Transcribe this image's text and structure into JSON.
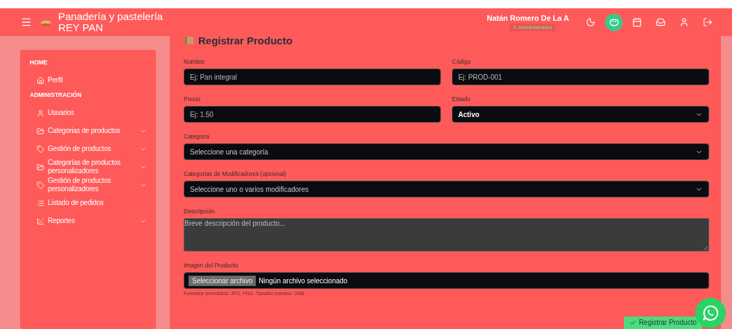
{
  "header": {
    "title_lines": [
      "Panadería y pastelería",
      "REY PAN"
    ],
    "user_name": "Natán Romero De La A",
    "user_role": "Administrador"
  },
  "sidebar": {
    "sections": [
      {
        "title": "HOME",
        "items": [
          {
            "label": "Perfil",
            "has_submenu": false
          }
        ]
      },
      {
        "title": "ADMINISTRACIÓN",
        "items": [
          {
            "label": "Usuarios",
            "has_submenu": false
          },
          {
            "label": "Categorias de productos",
            "has_submenu": true
          },
          {
            "label": "Gestión de productos",
            "has_submenu": true
          },
          {
            "label": "Categorías de productos personalizadores",
            "has_submenu": true
          },
          {
            "label": "Gestión de productos personalizadores",
            "has_submenu": true
          },
          {
            "label": "Listado de pedidos",
            "has_submenu": false
          },
          {
            "label": "Reportes",
            "has_submenu": true
          }
        ]
      }
    ]
  },
  "form": {
    "title": "Registrar Producto",
    "rows": [
      [
        {
          "kind": "input",
          "label": "Nombre",
          "placeholder": "Ej: Pan integral"
        },
        {
          "kind": "input",
          "label": "Código",
          "placeholder": "Ej: PROD-001"
        }
      ],
      [
        {
          "kind": "input",
          "label": "Precio",
          "placeholder": "Ej: 1.50"
        },
        {
          "kind": "select",
          "label": "Estado",
          "value": "Activo"
        }
      ],
      [
        {
          "kind": "select",
          "label": "Categoria",
          "placeholder": "Seleccione una categoría"
        }
      ],
      [
        {
          "kind": "select",
          "label": "Categorias de Modificadores (opcional)",
          "placeholder": "Seleccione uno o varios modificadores"
        }
      ],
      [
        {
          "kind": "textarea",
          "label": "Descripción",
          "placeholder": "Breve descripción del producto..."
        }
      ],
      [
        {
          "kind": "file",
          "label": "Imagen del Producto",
          "button": "Seleccionar archivo",
          "value": "Ningún archivo seleccionado",
          "hint": "Formatos permitidos: JPG, PNG. Tamaño máximo: 2MB."
        }
      ]
    ],
    "submit": "Registrar Producto"
  }
}
